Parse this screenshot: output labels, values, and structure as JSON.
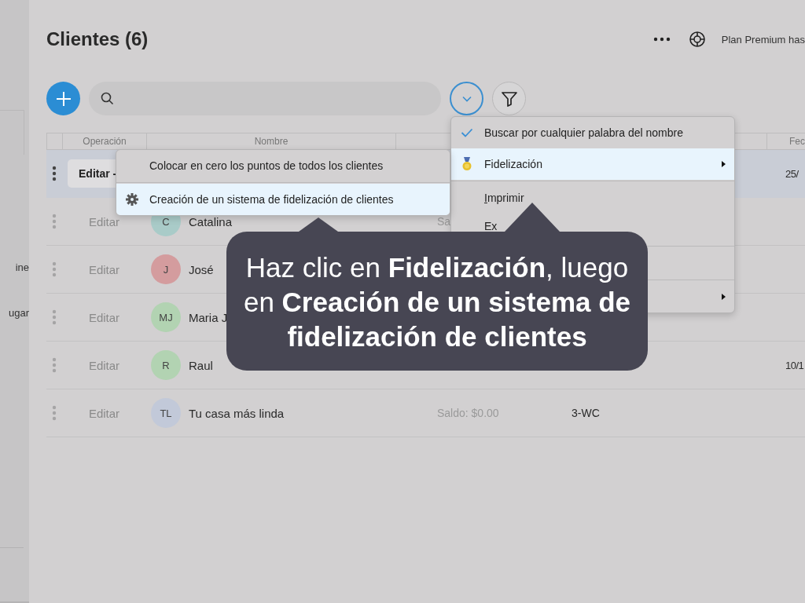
{
  "sidebar": {
    "items": [
      {
        "label": "ine"
      },
      {
        "label": "ugar"
      }
    ]
  },
  "header": {
    "title": "Clientes (6)",
    "plan": "Plan Premium has"
  },
  "table": {
    "columns": [
      "Operación",
      "Nombre",
      "Fec"
    ],
    "rows": [
      {
        "selected": true,
        "operation": "Editar -",
        "date": "25/"
      },
      {
        "selected": false,
        "operation": "Editar",
        "initials": "C",
        "color": "#a9cbc8",
        "name": "Catalina",
        "balance": "Sa"
      },
      {
        "selected": false,
        "operation": "Editar",
        "initials": "J",
        "color": "#d49c9e",
        "name": "José"
      },
      {
        "selected": false,
        "operation": "Editar",
        "initials": "MJ",
        "color": "#b2d3b2",
        "name": "Maria J"
      },
      {
        "selected": false,
        "operation": "Editar",
        "initials": "R",
        "color": "#b2d3b2",
        "name": "Raul",
        "date": "10/1"
      },
      {
        "selected": false,
        "operation": "Editar",
        "initials": "TL",
        "color": "#c2c9d9",
        "name": "Tu casa más linda",
        "balance": "Saldo: $0.00",
        "code": "3-WC"
      }
    ]
  },
  "menu": {
    "items": [
      {
        "kind": "check",
        "label": "Buscar por cualquier palabra del nombre",
        "checked": true,
        "selected": false
      },
      {
        "kind": "medal",
        "label": "Fidelización",
        "submenu": true,
        "selected": true
      },
      {
        "kind": "separator"
      },
      {
        "kind": "plain",
        "label": "Imprimir",
        "mnemonic": true,
        "selected": false
      },
      {
        "kind": "plain",
        "label": "Ex",
        "selected": false
      },
      {
        "kind": "separator"
      },
      {
        "kind": "hidden"
      },
      {
        "kind": "separator"
      },
      {
        "kind": "hidden",
        "submenu": true
      }
    ]
  },
  "submenu": {
    "items": [
      {
        "kind": "plain",
        "label": "Colocar en cero los puntos de todos los clientes",
        "selected": false
      },
      {
        "kind": "separator"
      },
      {
        "kind": "gear",
        "label": "Creación de un sistema de fidelización de clientes",
        "selected": true
      }
    ]
  },
  "hint": {
    "text": "Haz clic en **Fidelización**, luego en **Creación de un sistema de fidelización de clientes**"
  }
}
